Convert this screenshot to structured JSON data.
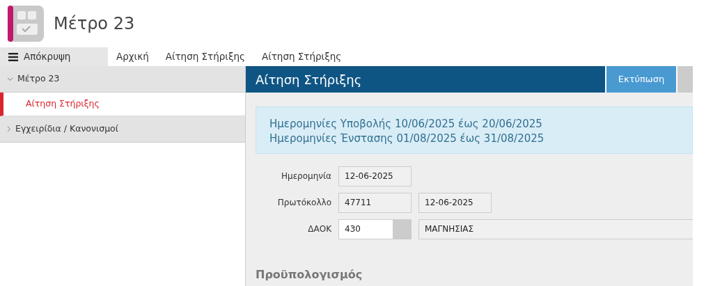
{
  "app": {
    "title": "Μέτρο 23"
  },
  "tabs": [
    {
      "label": "Απόκρυψη",
      "kind": "toggle",
      "selected": true
    },
    {
      "label": "Αρχική",
      "kind": "tab",
      "selected": false
    },
    {
      "label": "Αίτηση Στήριξης",
      "kind": "tab",
      "selected": false
    },
    {
      "label": "Αίτηση Στήριξης",
      "kind": "tab",
      "selected": false
    }
  ],
  "sidebar": {
    "items": [
      {
        "label": "Μέτρο 23",
        "expanded": true,
        "children": [
          {
            "label": "Αίτηση Στήριξης",
            "selected": true
          }
        ]
      },
      {
        "label": "Εγχειρίδια / Κανονισμοί",
        "expanded": false
      }
    ]
  },
  "panel": {
    "title": "Αίτηση Στήριξης",
    "buttons": [
      {
        "label": "Εκτύπωση",
        "kind": "primary"
      },
      {
        "kind": "cut"
      }
    ],
    "notice": [
      "Ημερομηνίες Υποβολής 10/06/2025 έως 20/06/2025",
      "Ημερομηνίες Ένστασης 01/08/2025 έως 31/08/2025"
    ],
    "form": [
      {
        "label": "Ημερομηνία",
        "fields": [
          {
            "value": "12-06-2025",
            "readonly": true
          }
        ]
      },
      {
        "label": "Πρωτόκολλο",
        "fields": [
          {
            "value": "47711",
            "readonly": true
          },
          {
            "value": "12-06-2025",
            "readonly": true
          }
        ]
      },
      {
        "label": "ΔΑΟΚ",
        "fields": [
          {
            "value": "430",
            "readonly": false,
            "lookup": true
          },
          {
            "value": "ΜΑΓΝΗΣΙΑΣ",
            "readonly": true,
            "wide": true
          }
        ]
      }
    ],
    "section": "Προϋπολογισμός"
  }
}
